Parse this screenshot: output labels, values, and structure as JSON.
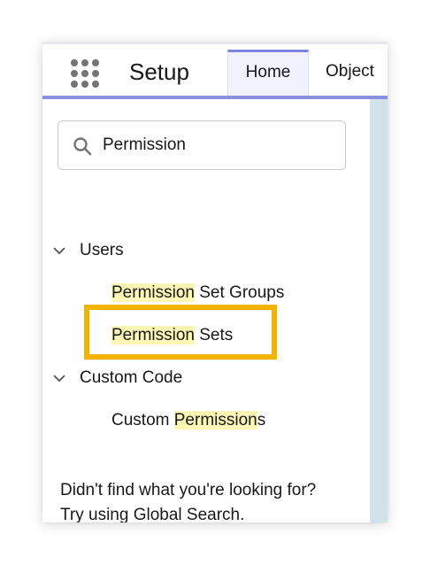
{
  "header": {
    "app_title": "Setup",
    "tabs": [
      {
        "label": "Home",
        "active": true
      },
      {
        "label": "Object",
        "active": false
      }
    ],
    "icons": {
      "launcher": "app-launcher-grid-icon"
    }
  },
  "search": {
    "value": "Permission",
    "icon": "search-icon"
  },
  "tree": {
    "users": {
      "label": "Users",
      "items": [
        {
          "highlight": "Permission",
          "rest": " Set Groups"
        },
        {
          "highlight": "Permission",
          "rest": " Sets"
        }
      ]
    },
    "custom_code": {
      "label": "Custom Code",
      "items": [
        {
          "prefix": "Custom ",
          "highlight": "Permission",
          "rest": "s"
        }
      ]
    }
  },
  "footer": {
    "line1": "Didn't find what you're looking for?",
    "line2": "Try using Global Search."
  },
  "colors": {
    "accent": "#8b8fe0",
    "match_highlight": "#fdf7b6",
    "callout_box": "#f3b400"
  }
}
